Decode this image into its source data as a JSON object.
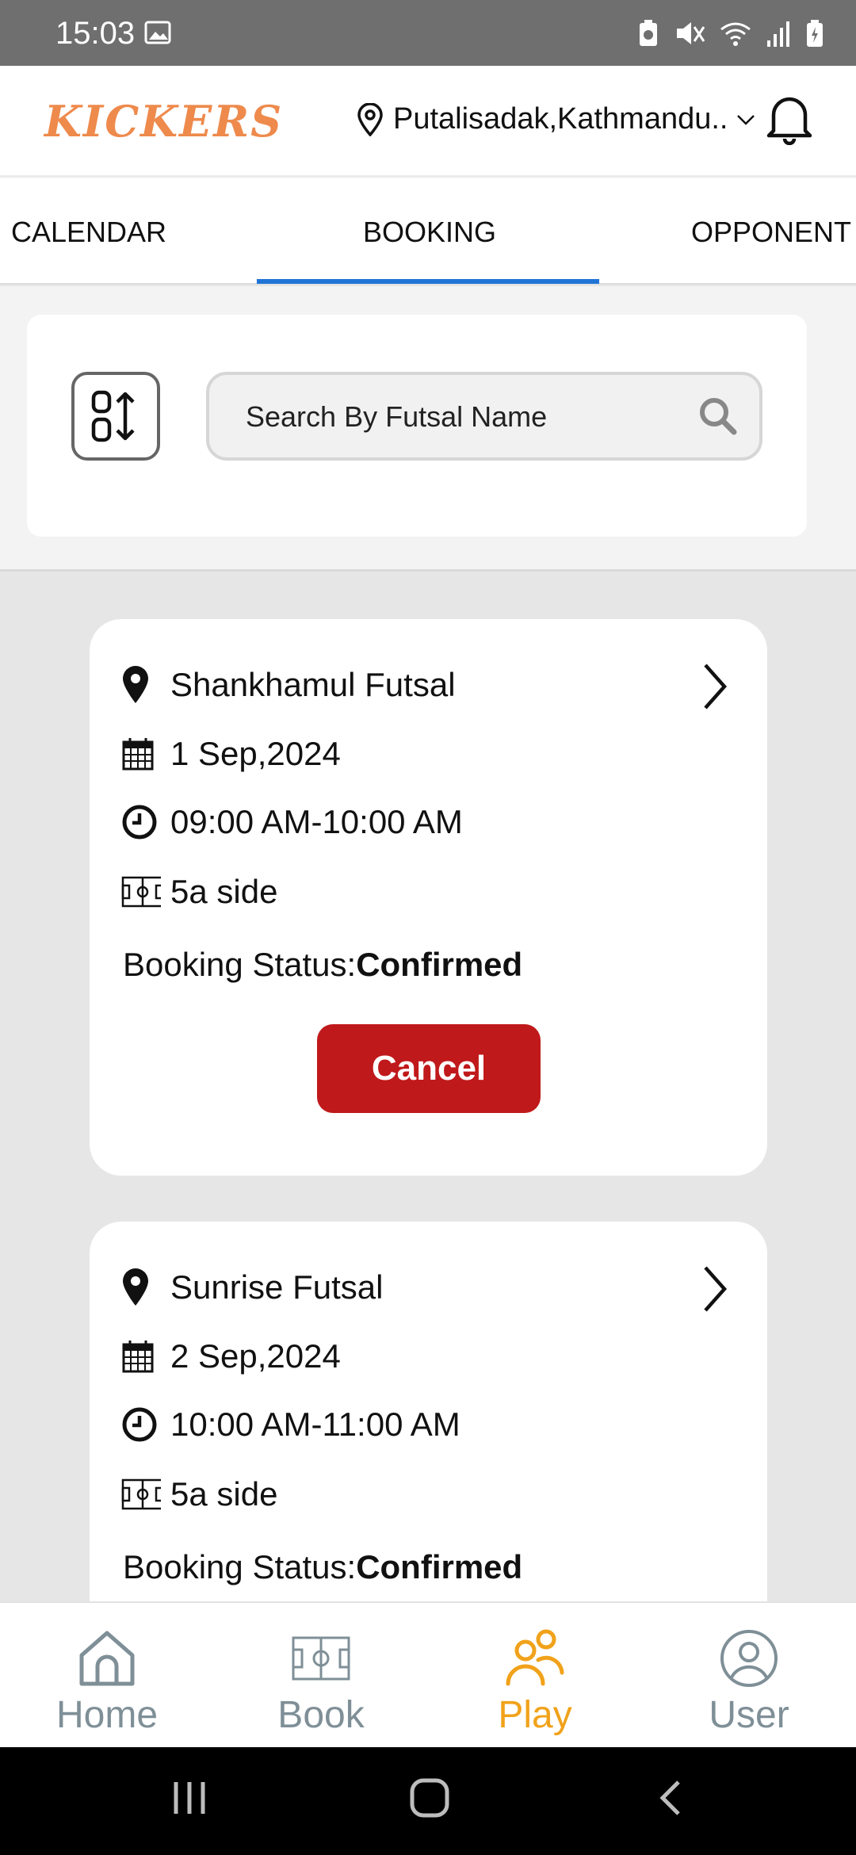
{
  "status_bar": {
    "time": "15:03"
  },
  "header": {
    "logo": "KICKERS",
    "location": "Putalisadak,Kathmandu.."
  },
  "tabs": [
    {
      "label": "CALENDAR",
      "active": false
    },
    {
      "label": "BOOKING",
      "active": true
    },
    {
      "label": "OPPONENT",
      "active": false
    }
  ],
  "search": {
    "placeholder": "Search By Futsal Name"
  },
  "bookings": [
    {
      "venue": "Shankhamul Futsal",
      "date": "1 Sep,2024",
      "time": "09:00 AM-10:00 AM",
      "type": "5a side",
      "status_label": "Booking Status:",
      "status_value": "Confirmed",
      "cancel_label": "Cancel"
    },
    {
      "venue": "Sunrise Futsal",
      "date": "2 Sep,2024",
      "time": "10:00 AM-11:00 AM",
      "type": "5a side",
      "status_label": "Booking Status:",
      "status_value": "Confirmed"
    }
  ],
  "bottom_nav": [
    {
      "label": "Home",
      "icon": "home-icon",
      "active": false
    },
    {
      "label": "Book",
      "icon": "pitch-icon",
      "active": false
    },
    {
      "label": "Play",
      "icon": "players-icon",
      "active": true
    },
    {
      "label": "User",
      "icon": "user-icon",
      "active": false
    }
  ],
  "colors": {
    "accent_tab": "#1f74d6",
    "cancel": "#c0191b",
    "nav_active": "#f1a21a",
    "nav_inactive": "#7f8f97",
    "logo": "#ee8a4c"
  }
}
